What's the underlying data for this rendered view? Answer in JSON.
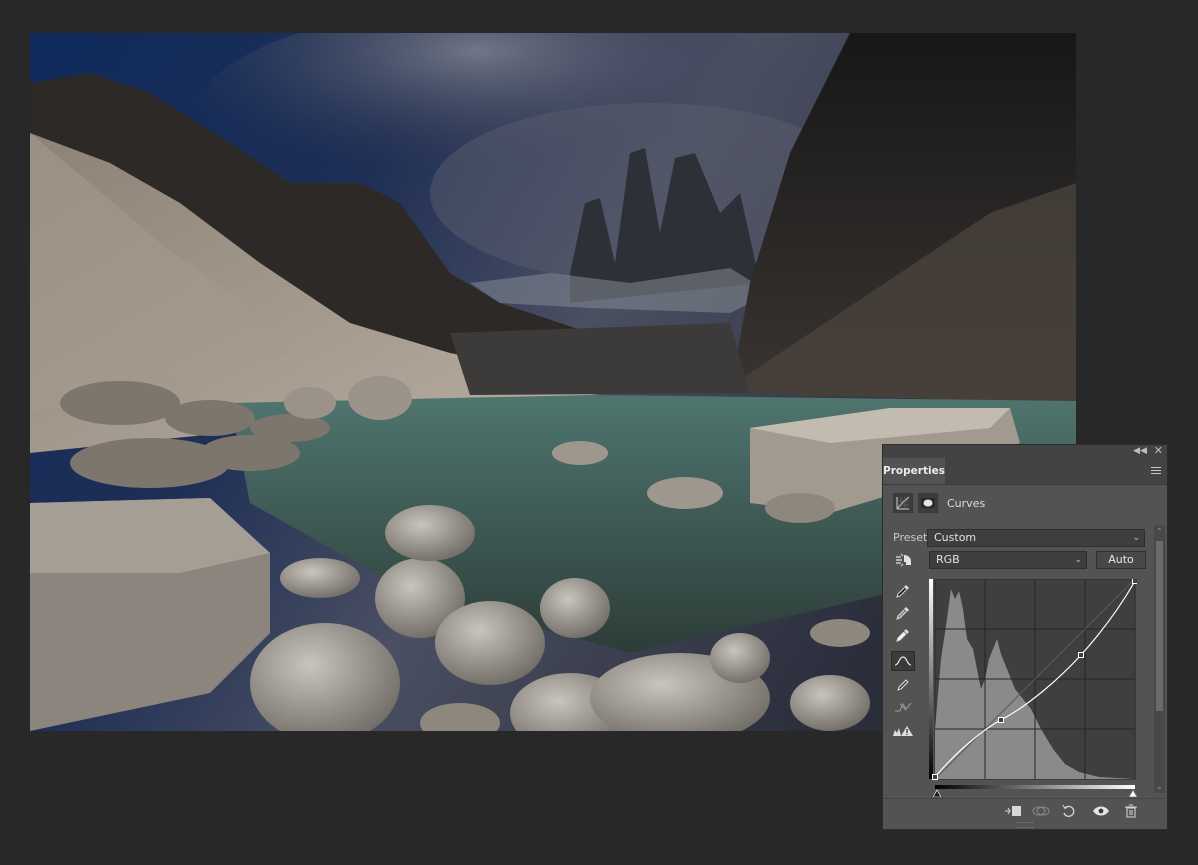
{
  "canvas": {
    "description_icon": "photo-canvas"
  },
  "properties_panel": {
    "tab_label": "Properties",
    "adjustment_title": "Curves",
    "preset_label": "Preset:",
    "preset_value": "Custom",
    "channel_value": "RGB",
    "auto_label": "Auto",
    "tools": [
      "eyedropper-black-icon",
      "eyedropper-gray-icon",
      "eyedropper-white-icon",
      "curve-point-tool-icon",
      "pencil-tool-icon",
      "smooth-curve-icon",
      "clipping-warning-icon"
    ],
    "footer_icons": [
      "clip-to-layer-icon",
      "view-previous-state-icon",
      "reset-icon",
      "visibility-eye-icon",
      "delete-icon"
    ]
  },
  "colors": {
    "panel_bg": "#535353",
    "app_bg": "#282828",
    "tab_bg": "#434343"
  }
}
